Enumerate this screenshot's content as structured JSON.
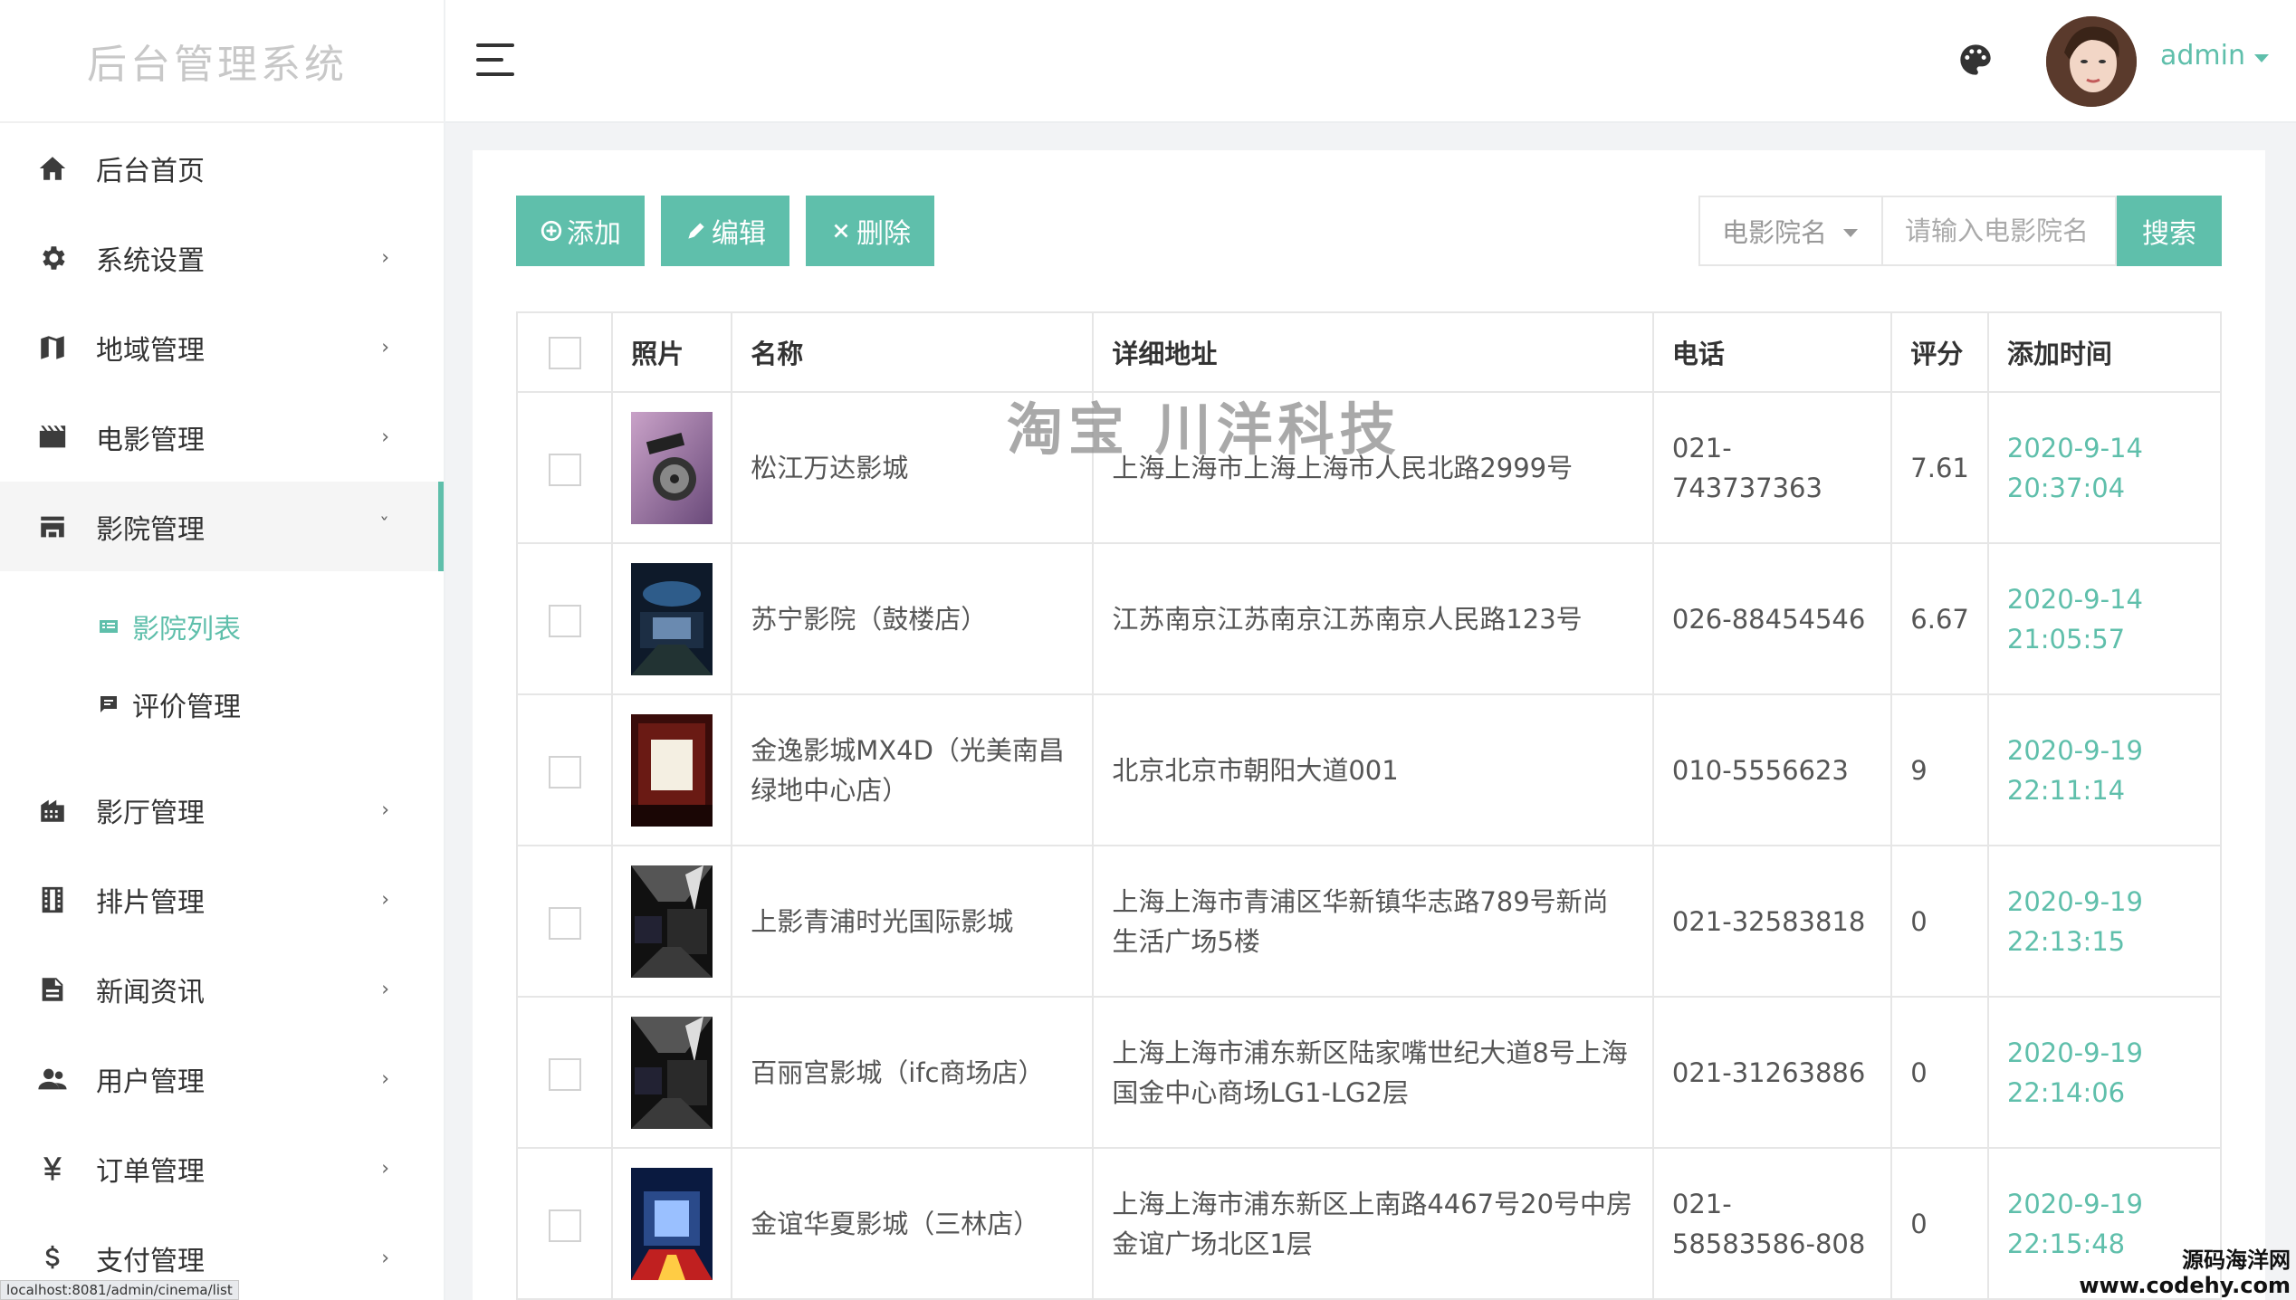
{
  "brand": "后台管理系统",
  "sidebar": {
    "items": [
      {
        "label": "后台首页",
        "icon": "home-icon"
      },
      {
        "label": "系统设置",
        "icon": "gear-icon"
      },
      {
        "label": "地域管理",
        "icon": "map-icon"
      },
      {
        "label": "电影管理",
        "icon": "film-icon"
      },
      {
        "label": "影院管理",
        "icon": "store-icon"
      },
      {
        "label": "影厅管理",
        "icon": "building-icon"
      },
      {
        "label": "排片管理",
        "icon": "filmstrip-icon"
      },
      {
        "label": "新闻资讯",
        "icon": "news-icon"
      },
      {
        "label": "用户管理",
        "icon": "users-icon"
      },
      {
        "label": "订单管理",
        "icon": "yen-icon"
      },
      {
        "label": "支付管理",
        "icon": "dollar-icon"
      }
    ],
    "sub_items": [
      {
        "label": "影院列表",
        "icon": "list-icon",
        "active": true
      },
      {
        "label": "评价管理",
        "icon": "comment-icon",
        "active": false
      }
    ],
    "chevron": "›",
    "chevron_open": "ˇ"
  },
  "header": {
    "username": "admin"
  },
  "toolbar": {
    "add_label": "添加",
    "edit_label": "编辑",
    "delete_label": "删除"
  },
  "search": {
    "field_label": "电影院名",
    "placeholder": "请输入电影院名",
    "button_label": "搜索"
  },
  "table": {
    "columns": [
      "照片",
      "名称",
      "详细地址",
      "电话",
      "评分",
      "添加时间"
    ],
    "rows": [
      {
        "name": "松江万达影城",
        "address": "上海上海市上海上海市人民北路2999号",
        "phone": "021-743737363",
        "score": "7.61",
        "date": "2020-9-14",
        "time": "20:37:04"
      },
      {
        "name": "苏宁影院（鼓楼店）",
        "address": "江苏南京江苏南京江苏南京人民路123号",
        "phone": "026-88454546",
        "score": "6.67",
        "date": "2020-9-14",
        "time": "21:05:57"
      },
      {
        "name": "金逸影城MX4D（光美南昌绿地中心店）",
        "address": "北京北京市朝阳大道001",
        "phone": "010-5556623",
        "score": "9",
        "date": "2020-9-19",
        "time": "22:11:14"
      },
      {
        "name": "上影青浦时光国际影城",
        "address": "上海上海市青浦区华新镇华志路789号新尚生活广场5楼",
        "phone": "021-32583818",
        "score": "0",
        "date": "2020-9-19",
        "time": "22:13:15"
      },
      {
        "name": "百丽宫影城（ifc商场店）",
        "address": "上海上海市浦东新区陆家嘴世纪大道8号上海国金中心商场LG1-LG2层",
        "phone": "021-31263886",
        "score": "0",
        "date": "2020-9-19",
        "time": "22:14:06"
      },
      {
        "name": "金谊华夏影城（三林店）",
        "address": "上海上海市浦东新区上南路4467号20号中房金谊广场北区1层",
        "phone": "021-58583586-808",
        "score": "0",
        "date": "2020-9-19",
        "time": "22:15:48"
      }
    ]
  },
  "watermark": "淘宝 川洋科技",
  "status_url": "localhost:8081/admin/cinema/list",
  "corner_mark": {
    "line1": "源码海洋网",
    "line2": "www.codehy.com"
  },
  "colors": {
    "accent": "#5fbfab",
    "muted": "#c8c8c8"
  }
}
